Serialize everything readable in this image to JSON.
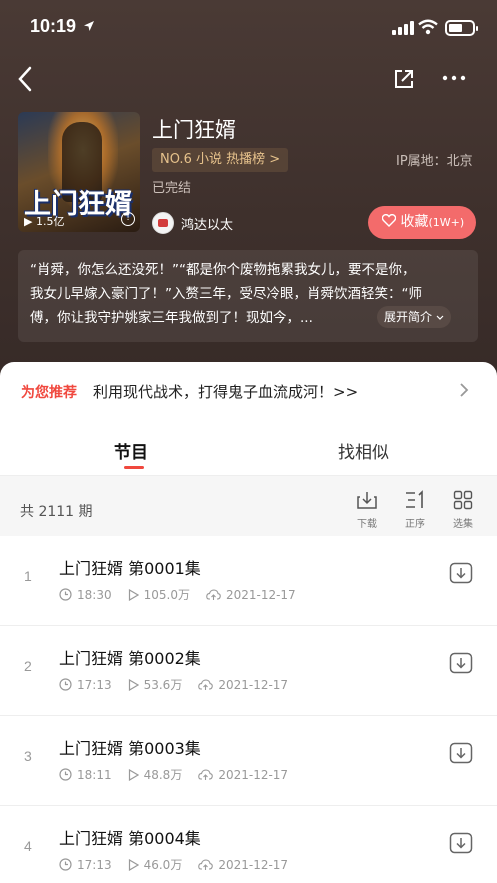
{
  "status_bar": {
    "time": "10:19"
  },
  "album": {
    "title": "上门狂婿",
    "rank_badge": "NO.6 小说 热播榜 >",
    "ip_location": "IP属地：北京",
    "status": "已完结",
    "author": "鸿达以太",
    "cover_title": "上门狂婿",
    "cover_plays": "▶ 1.5亿",
    "favorite_label": "收藏",
    "favorite_count": "(1W+)",
    "intro_line1": "“肖舜，你怎么还没死！”“都是你个废物拖累我女儿，要不是你，",
    "intro_line2": "我女儿早嫁入豪门了！”入赘三年，受尽冷眼，肖舜饮酒轻笑：“师",
    "intro_line3": "傅，你让我守护姚家三年我做到了！现如今，...",
    "expand_label": "展开简介"
  },
  "recommend": {
    "label": "为您推荐",
    "text": "利用现代战术，打得鬼子血流成河！>>"
  },
  "tabs": [
    {
      "label": "节目",
      "active": true
    },
    {
      "label": "找相似",
      "active": false
    }
  ],
  "list_toolbar": {
    "count": "共 2111 期",
    "download_label": "下载",
    "order_label": "正序",
    "select_label": "选集"
  },
  "episodes": [
    {
      "no": "1",
      "title": "上门狂婿 第0001集",
      "duration": "18:30",
      "plays": "105.0万",
      "date": "2021-12-17"
    },
    {
      "no": "2",
      "title": "上门狂婿 第0002集",
      "duration": "17:13",
      "plays": "53.6万",
      "date": "2021-12-17"
    },
    {
      "no": "3",
      "title": "上门狂婿 第0003集",
      "duration": "18:11",
      "plays": "48.8万",
      "date": "2021-12-17"
    },
    {
      "no": "4",
      "title": "上门狂婿 第0004集",
      "duration": "17:13",
      "plays": "46.0万",
      "date": "2021-12-17"
    }
  ],
  "colors": {
    "accent": "#f0483e",
    "favorite": "#f36b6b",
    "rank_gold": "#e6c28c",
    "header_bg": "#3e302c"
  }
}
